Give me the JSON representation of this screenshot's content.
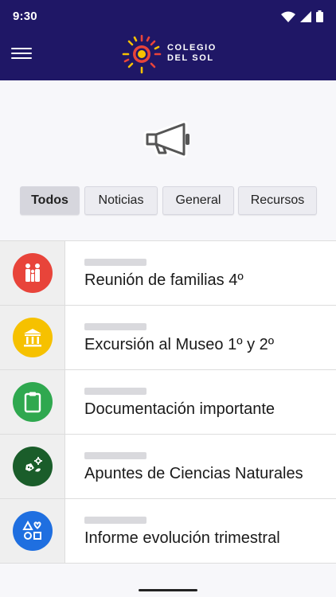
{
  "status_bar": {
    "time": "9:30",
    "icons": [
      "wifi-icon",
      "signal-icon",
      "battery-icon"
    ]
  },
  "header": {
    "menu_icon": "hamburger-menu-icon",
    "brand_line1": "COLEGIO",
    "brand_line2": "DEL SOL",
    "colors": {
      "background": "#1f1766"
    }
  },
  "hero_icon": "megaphone-icon",
  "tabs": [
    {
      "label": "Todos",
      "active": true
    },
    {
      "label": "Noticias",
      "active": false
    },
    {
      "label": "General",
      "active": false
    },
    {
      "label": "Recursos",
      "active": false
    }
  ],
  "items": [
    {
      "title": "Reunión de familias 4º",
      "icon": "family-icon",
      "color": "#e8443a"
    },
    {
      "title": "Excursión al Museo 1º y 2º",
      "icon": "museum-icon",
      "color": "#f6c100"
    },
    {
      "title": "Documentación importante",
      "icon": "clipboard-icon",
      "color": "#2fa84f"
    },
    {
      "title": "Apuntes de Ciencias Naturales",
      "icon": "science-icon",
      "color": "#1a5d2a"
    },
    {
      "title": "Informe evolución trimestral",
      "icon": "shapes-icon",
      "color": "#1f6fe0"
    }
  ]
}
